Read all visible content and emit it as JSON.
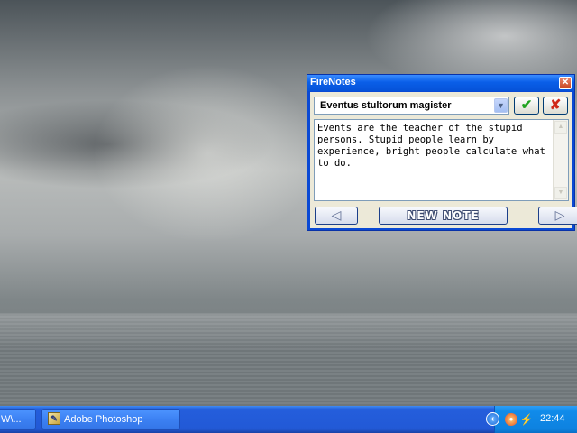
{
  "firenotes": {
    "title": "FireNotes",
    "note_title": "Eventus stultorum magister",
    "note_text": "Events are the teacher of the stupid persons. Stupid people learn by experience, bright people calculate what to do.",
    "new_note_label": "NEW NOTE"
  },
  "taskbar": {
    "items": [
      {
        "label": "W\\..."
      },
      {
        "label": "Adobe Photoshop",
        "icon": "photoshop-icon"
      }
    ],
    "tray": {
      "clock": "22:44",
      "icons": [
        "chevron-left-icon",
        "firefox-icon",
        "network-icon"
      ]
    }
  },
  "colors": {
    "titlebar": "#0a5fe8",
    "taskbar": "#245edc",
    "tray": "#108bea"
  }
}
